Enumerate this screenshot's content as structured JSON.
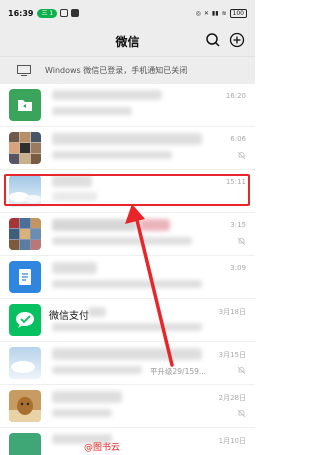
{
  "status_bar": {
    "time": "16:39",
    "badge": "三 1",
    "battery": "100"
  },
  "header": {
    "title": "微信"
  },
  "notice": {
    "text": "Windows 微信已登录，手机通知已关闭"
  },
  "chats": [
    {
      "name": "",
      "preview": "",
      "time": "16:20",
      "muted": false
    },
    {
      "name": "",
      "preview": "",
      "time": "6:06",
      "muted": true
    },
    {
      "name": "",
      "preview": "",
      "time": "15:11",
      "muted": false
    },
    {
      "name": "",
      "preview": "",
      "time": "3:15",
      "muted": true
    },
    {
      "name": "",
      "preview": "",
      "time": "3:09",
      "muted": false
    },
    {
      "name": "微信支付",
      "preview": "",
      "time": "3月18日",
      "muted": false
    },
    {
      "name": "",
      "preview": "平升级29/159...",
      "time": "3月15日",
      "muted": true
    },
    {
      "name": "",
      "preview": "",
      "time": "2月28日",
      "muted": true
    },
    {
      "name": "",
      "preview": "",
      "time": "1月10日",
      "muted": false
    }
  ],
  "watermark": "@图书云",
  "colors": {
    "wechat_green": "#07c160",
    "highlight_red": "#e8262a",
    "header_bg": "#ededed"
  }
}
